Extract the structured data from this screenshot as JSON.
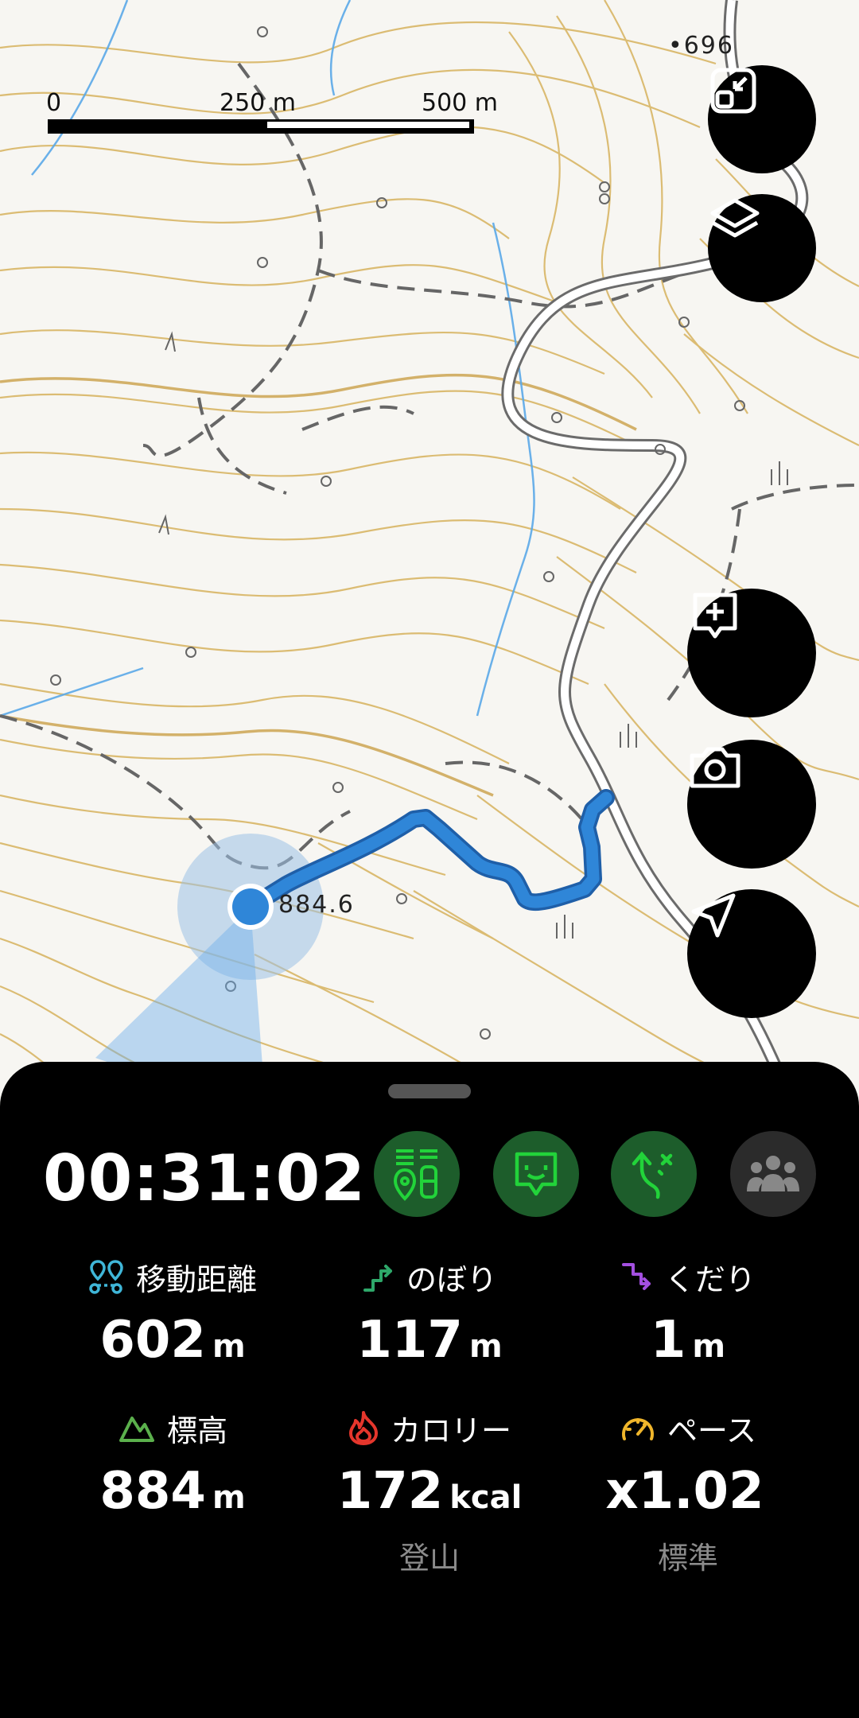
{
  "map": {
    "scale": {
      "zero": "0",
      "mid": "250 m",
      "end": "500 m"
    },
    "spot_heights": [
      "696",
      "884.6"
    ]
  },
  "map_buttons": [
    {
      "name": "fit-route-button",
      "icon": "fit-to-screen-icon"
    },
    {
      "name": "layers-button",
      "icon": "layers-icon"
    },
    {
      "name": "add-memo-button",
      "icon": "add-memo-icon"
    },
    {
      "name": "camera-button",
      "icon": "camera-icon"
    },
    {
      "name": "current-location-button",
      "icon": "navigation-arrow-icon"
    }
  ],
  "panel": {
    "timer": "00:31:02",
    "mode_buttons": [
      {
        "icon": "hiker-gear-icon",
        "active": true,
        "color": "#22d33a"
      },
      {
        "icon": "mountain-face-icon",
        "active": true,
        "color": "#22d33a"
      },
      {
        "icon": "route-branch-icon",
        "active": true,
        "color": "#22d33a"
      },
      {
        "icon": "group-icon",
        "active": false,
        "color": "#888888"
      }
    ],
    "stats": [
      {
        "label": "移動距離",
        "value": "602",
        "unit": "m",
        "sub": "",
        "icon": "distance-icon",
        "color": "#3fb6d8"
      },
      {
        "label": "のぼり",
        "value": "117",
        "unit": "m",
        "sub": "",
        "icon": "ascent-icon",
        "color": "#2ea86a"
      },
      {
        "label": "くだり",
        "value": "1",
        "unit": "m",
        "sub": "",
        "icon": "descent-icon",
        "color": "#a34fe0"
      },
      {
        "label": "標高",
        "value": "884",
        "unit": "m",
        "sub": "",
        "icon": "mountain-icon",
        "color": "#5bb04c"
      },
      {
        "label": "カロリー",
        "value": "172",
        "unit": "kcal",
        "sub": "登山",
        "icon": "flame-icon",
        "color": "#e5362c"
      },
      {
        "label": "ペース",
        "value": "x1.02",
        "unit": "",
        "sub": "標準",
        "icon": "speedometer-icon",
        "color": "#f0b62b"
      }
    ]
  },
  "colors": {
    "track": "#2f86d8",
    "contour": "#d7b25e",
    "road": "#666666",
    "river": "#5aa8e8"
  }
}
